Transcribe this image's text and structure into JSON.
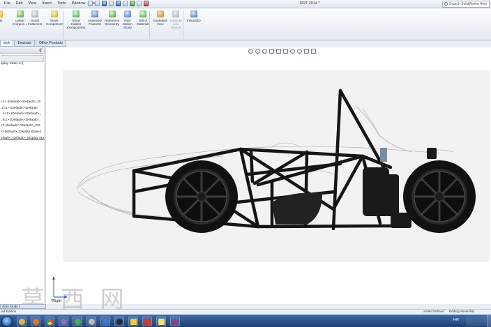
{
  "menu": [
    "File",
    "Edit",
    "View",
    "Insert",
    "Tools",
    "Window",
    "Help"
  ],
  "document_title": "RRT 2014 *",
  "search_placeholder": "Search SolidWorks Help",
  "ribbon": [
    {
      "label": "Insert\nComponents",
      "icon": "insert-components-icon",
      "color": "y",
      "enabled": true,
      "partial": "ents"
    },
    {
      "label": "Linear\nCompon...",
      "icon": "linear-pattern-icon",
      "color": "g",
      "enabled": true
    },
    {
      "label": "Smart\nFasteners",
      "icon": "smart-fasteners-icon",
      "color": "gr",
      "enabled": true
    },
    {
      "label": "Move\nComponent",
      "icon": "move-component-icon",
      "color": "y",
      "enabled": true
    },
    {
      "label": "Show\nHidden\nComponents",
      "icon": "show-hidden-icon",
      "color": "g",
      "enabled": true
    },
    {
      "label": "Assembly\nFeatures",
      "icon": "assembly-features-icon",
      "color": "b",
      "enabled": true
    },
    {
      "label": "Reference\nGeometry",
      "icon": "reference-geometry-icon",
      "color": "g",
      "enabled": true
    },
    {
      "label": "New\nMotion\nStudy",
      "icon": "new-motion-study-icon",
      "color": "b",
      "enabled": true
    },
    {
      "label": "Bill of\nMaterials",
      "icon": "bill-of-materials-icon",
      "color": "g",
      "enabled": true
    },
    {
      "label": "Exploded\nView",
      "icon": "exploded-view-icon",
      "color": "o",
      "enabled": true
    },
    {
      "label": "Explode\nLine\nSketch",
      "icon": "explode-line-icon",
      "color": "gr",
      "enabled": false
    },
    {
      "label": "Instant3D",
      "icon": "instant3d-icon",
      "color": "b",
      "enabled": true
    }
  ],
  "tabs": [
    {
      "label": "etch",
      "active": true
    },
    {
      "label": "Evaluate",
      "active": false
    },
    {
      "label": "Office Products",
      "active": false
    }
  ],
  "tree": {
    "display_state": "splay State-1>)",
    "items": [
      "<1> (Default<<Default>_Di",
      ".1<1> (Default<<Default>",
      "..1<1> (Default<<Default>_",
      "..]<1> (Default<<Default>_",
      "<7 (Default<<Default>_Dis",
      "<<Default>_Display State-1",
      "efault<_Default>_Display Sta"
    ]
  },
  "triad_label": "*Right",
  "motion_tab": "otion Study 1",
  "status": {
    "edition": "ed Edition",
    "definition": "Under Defined",
    "mode": "Editing Assembly"
  },
  "taskbar": {
    "language": "HR"
  },
  "watermark": "莫 西 网"
}
